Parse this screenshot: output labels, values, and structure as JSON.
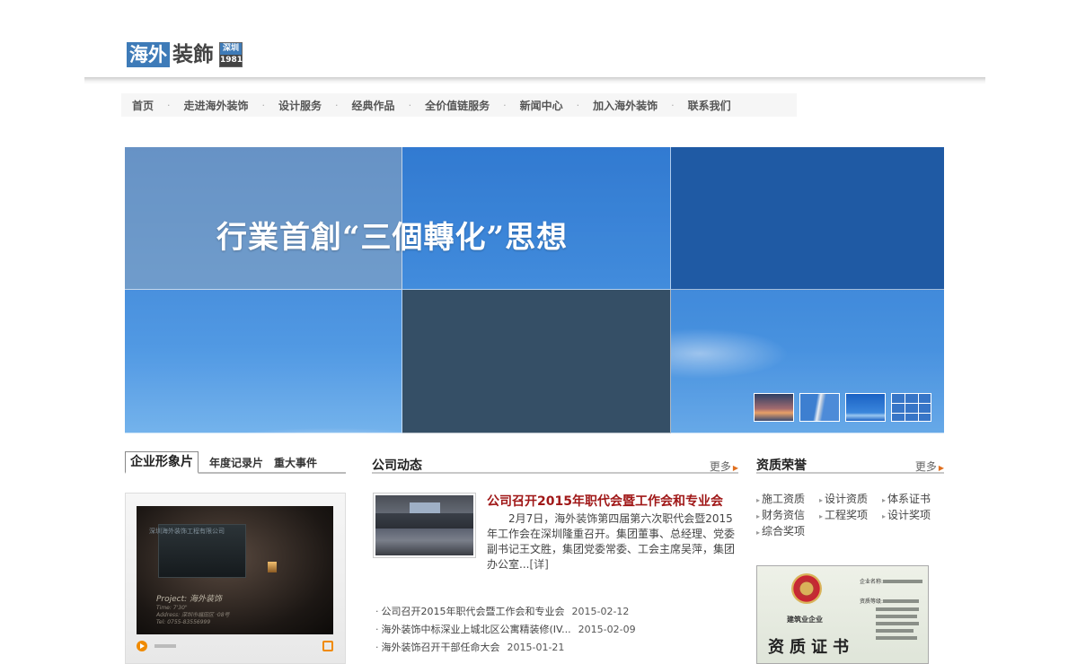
{
  "logo": {
    "part1": "海外",
    "part2": "装飾",
    "tag_top": "深圳",
    "tag_bottom": "1981"
  },
  "nav": [
    "首页",
    "走进海外装饰",
    "设计服务",
    "经典作品",
    "全价值链服务",
    "新闻中心",
    "加入海外装饰",
    "联系我们"
  ],
  "nav_separator": "·",
  "banner": {
    "title": "行業首創“三個轉化”思想"
  },
  "video_section": {
    "tabs": [
      "企业形象片",
      "年度记录片",
      "重大事件"
    ],
    "active_tab": "企业形象片",
    "sign_text": "深圳海外装饰工程有限公司",
    "project_line": "Project: 海外装饰",
    "info_lines": [
      "Time: 7'30\"",
      "Address: 深圳市福田区 ·08号",
      "Tel: 0755-83556999"
    ]
  },
  "news": {
    "title": "公司动态",
    "more": "更多",
    "headline": "公司召开2015年职代会暨工作会和专业会",
    "summary": "2月7日，海外装饰第四届第六次职代会暨2015年工作会在深圳隆重召开。集团董事、总经理、党委副书记王文胜，集团党委常委、工会主席吴萍，集团办公室...",
    "detail_link": "[详]",
    "items": [
      {
        "title": "公司召开2015年职代会暨工作会和专业会",
        "date": "2015-02-12"
      },
      {
        "title": "海外装饰中标深业上城北区公寓精装修(IV...",
        "date": "2015-02-09"
      },
      {
        "title": "海外装饰召开干部任命大会",
        "date": "2015-01-21"
      }
    ]
  },
  "honors": {
    "title": "资质荣誉",
    "more": "更多",
    "links": [
      "施工资质",
      "设计资质",
      "体系证书",
      "财务资信",
      "工程奖项",
      "设计奖项",
      "综合奖项"
    ],
    "certificate": {
      "subtitle": "建筑业企业",
      "title": "资质证书",
      "label1": "企业名称:",
      "label2": "资质等级:"
    }
  },
  "colors": {
    "accent_blue": "#3e7bb8",
    "headline_red": "#a01818",
    "more_arrow": "#e07020"
  }
}
